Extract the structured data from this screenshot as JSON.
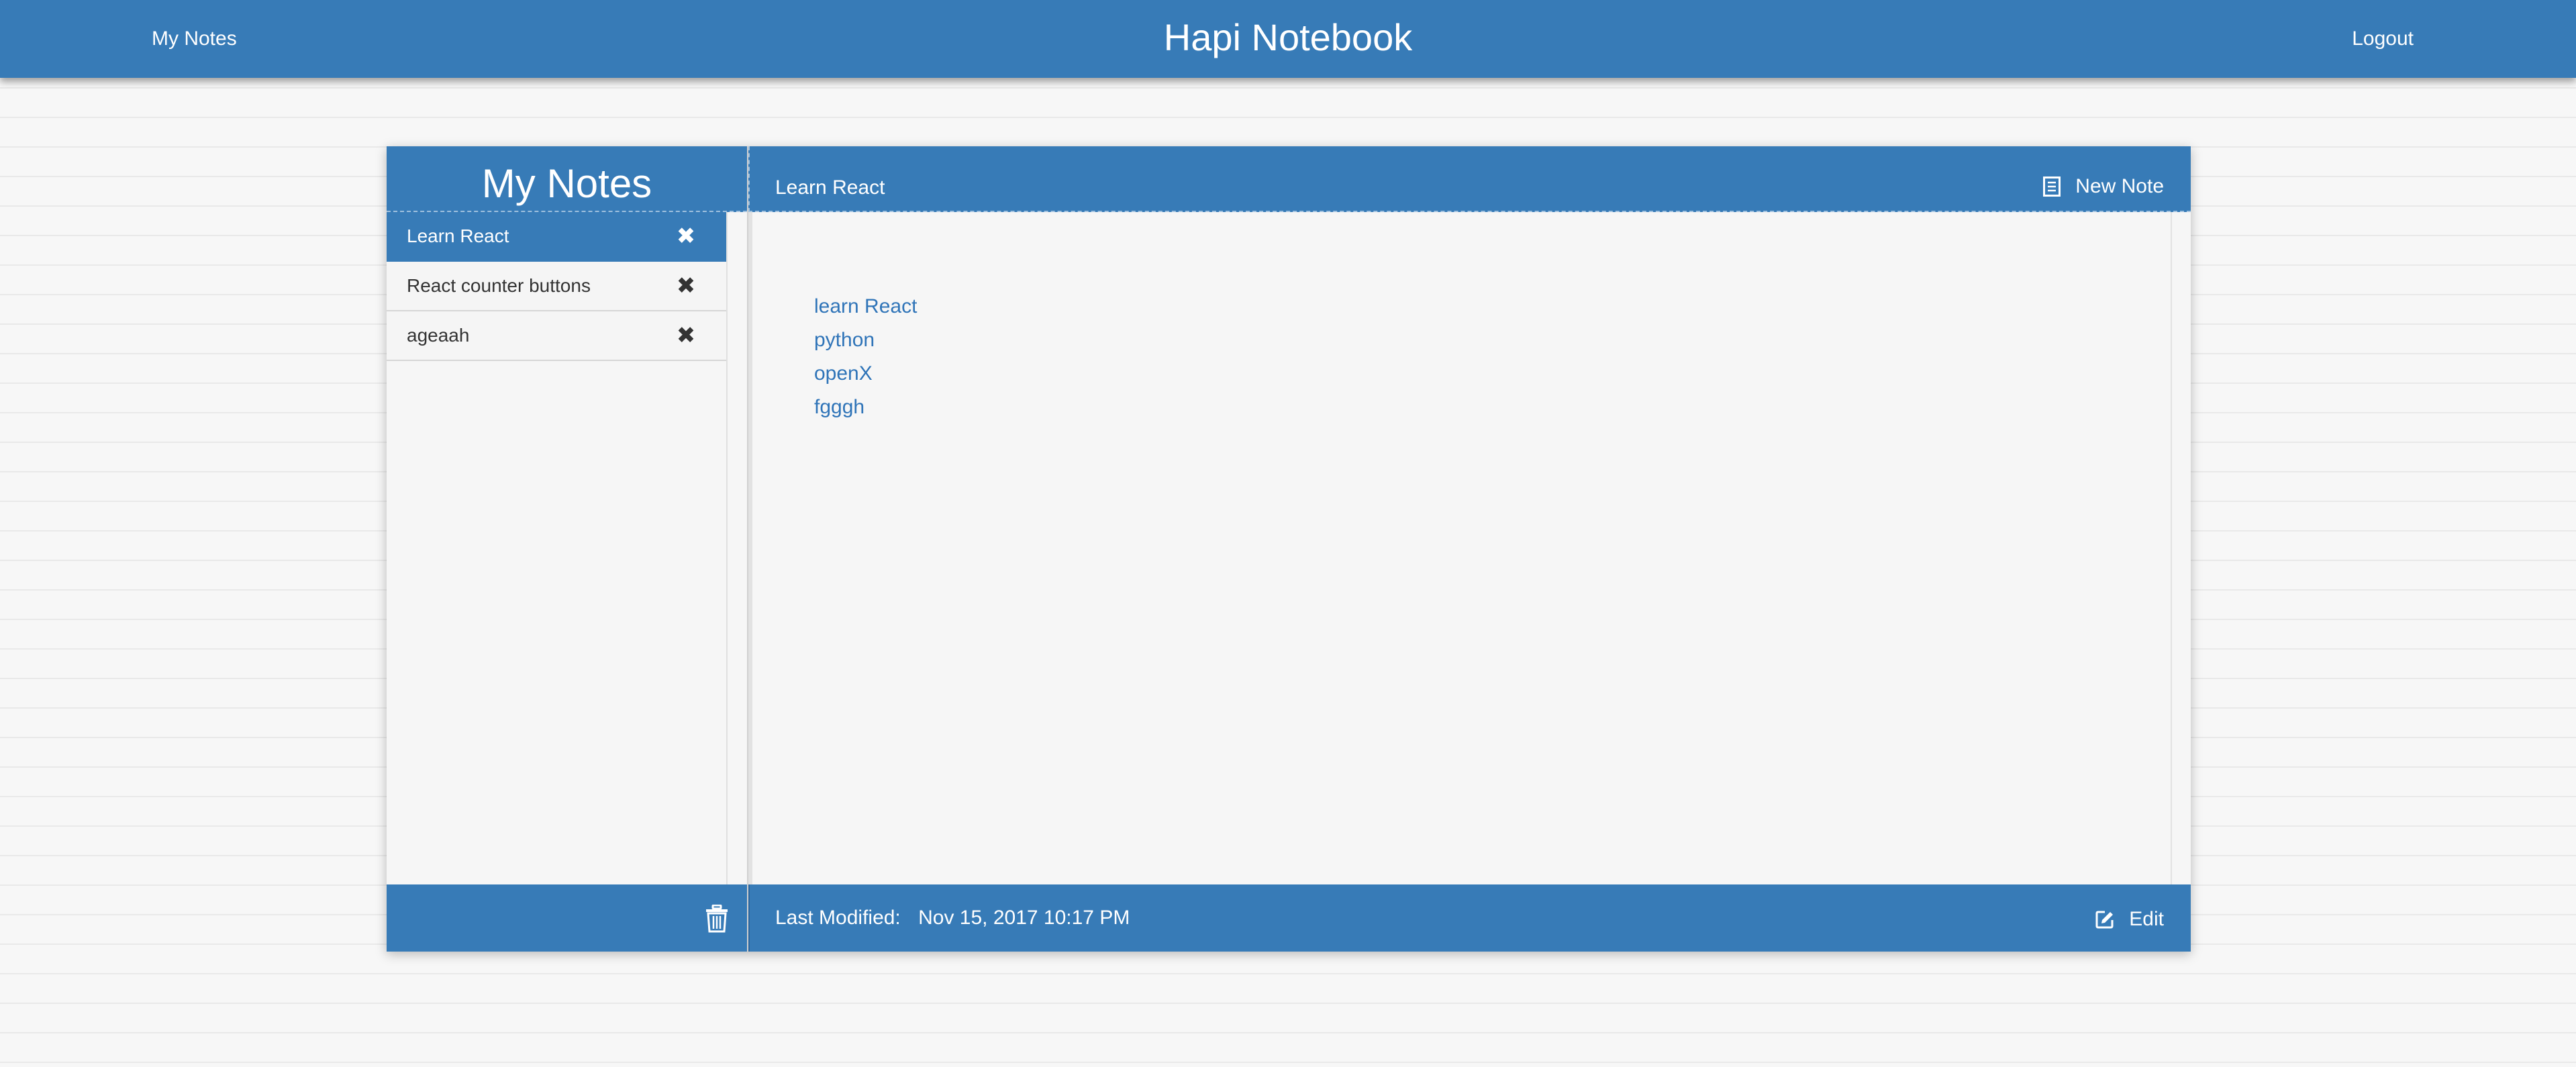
{
  "nav": {
    "left_link": "My Notes",
    "title": "Hapi Notebook",
    "right_link": "Logout"
  },
  "sidebar": {
    "title": "My Notes",
    "notes": [
      {
        "title": "Learn React",
        "active": true
      },
      {
        "title": "React counter buttons",
        "active": false
      },
      {
        "title": "ageaah",
        "active": false
      }
    ],
    "close_icon": "close-icon",
    "footer_icon": "trash-icon"
  },
  "content": {
    "note_title": "Learn React",
    "new_note_label": "New Note",
    "new_note_icon": "document-icon",
    "items": [
      "learn React",
      "python",
      "openX",
      "fgggh"
    ],
    "modified_label": "Last Modified:",
    "modified_value": "Nov 15, 2017 10:17 PM",
    "edit_label": "Edit",
    "edit_icon": "edit-icon"
  },
  "colors": {
    "primary": "#377bb7",
    "link": "#2f74b8",
    "background": "#f7f7f7"
  }
}
